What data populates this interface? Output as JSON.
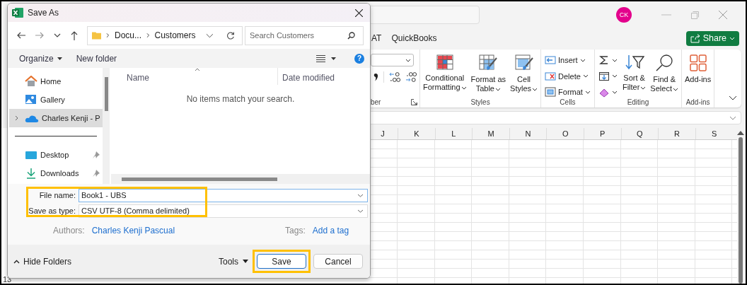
{
  "excel": {
    "avatar": "CK",
    "ribbon_tabs": [
      {
        "label": "AT",
        "selected": false
      },
      {
        "label": "QuickBooks",
        "selected": false
      }
    ],
    "share_button": "Share",
    "ribbon_groups": [
      {
        "kind": "number",
        "label": "ber"
      },
      {
        "kind": "standard",
        "label": "Styles",
        "large": [
          {
            "kind": "conditional-formatting",
            "lines": [
              "Conditional",
              "Formatting"
            ],
            "menu": true
          },
          {
            "kind": "format-as-table",
            "lines": [
              "Format as",
              "Table"
            ],
            "menu": true
          },
          {
            "kind": "cell-styles",
            "lines": [
              "Cell",
              "Styles"
            ],
            "menu": true
          }
        ]
      },
      {
        "kind": "standard",
        "label": "Cells",
        "small": [
          {
            "kind": "insert",
            "label": "Insert"
          },
          {
            "kind": "delete",
            "label": "Delete"
          },
          {
            "kind": "format",
            "label": "Format"
          }
        ]
      },
      {
        "kind": "standard",
        "label": "Editing",
        "small": [
          {
            "kind": "autosum"
          },
          {
            "kind": "fill"
          },
          {
            "kind": "clear"
          }
        ],
        "large": [
          {
            "kind": "sort-filter",
            "lines": [
              "Sort &",
              "Filter"
            ],
            "menu": true
          },
          {
            "kind": "find-select",
            "lines": [
              "Find &",
              "Select"
            ],
            "menu": true
          }
        ]
      },
      {
        "kind": "standard",
        "label": "Add-ins",
        "large": [
          {
            "kind": "add-ins",
            "lines": [
              "Add-ins"
            ],
            "menu": false
          }
        ]
      }
    ],
    "columns": [
      "J",
      "K",
      "L",
      "M",
      "N",
      "O",
      "P",
      "Q",
      "R",
      "S"
    ],
    "row_numbers": [
      "13"
    ]
  },
  "dialog": {
    "title": "Save As",
    "breadcrumb": [
      "Docu...",
      "Customers"
    ],
    "search": {
      "placeholder": "Search Customers"
    },
    "toolbar": [
      {
        "label": "Organize",
        "menu": true
      },
      {
        "label": "New folder",
        "menu": false
      }
    ],
    "help": "?",
    "sidebar_sections": [
      {
        "items": [
          {
            "kind": "home",
            "label": "Home",
            "selected": false,
            "expandable": false,
            "pinned": false
          },
          {
            "kind": "gallery",
            "label": "Gallery",
            "selected": false,
            "expandable": false,
            "pinned": false
          },
          {
            "kind": "cloud",
            "label": "Charles Kenji - P",
            "selected": true,
            "expandable": true,
            "pinned": false
          }
        ]
      },
      {
        "items": [
          {
            "kind": "desktop",
            "label": "Desktop",
            "selected": false,
            "expandable": false,
            "pinned": true
          },
          {
            "kind": "downloads",
            "label": "Downloads",
            "selected": false,
            "expandable": false,
            "pinned": true
          }
        ]
      }
    ],
    "columns": [
      {
        "label": "Name",
        "sorted": true
      },
      {
        "label": "Date modified",
        "sorted": false
      }
    ],
    "empty_message": "No items match your search.",
    "fields": [
      {
        "label": "File name:",
        "value": "Book1 - UBS"
      },
      {
        "label": "Save as type:",
        "value": "CSV UTF-8 (Comma delimited)"
      }
    ],
    "fields_highlighted": true,
    "meta": [
      {
        "label": "Authors:",
        "value": "Charles Kenji Pascual"
      },
      {
        "label": "Tags:",
        "value": "Add a tag"
      }
    ],
    "hide_folders": "Hide Folders",
    "tools": "Tools",
    "buttons": [
      {
        "label": "Save",
        "default": true,
        "highlighted": true
      },
      {
        "label": "Cancel",
        "default": false,
        "highlighted": false
      }
    ]
  }
}
